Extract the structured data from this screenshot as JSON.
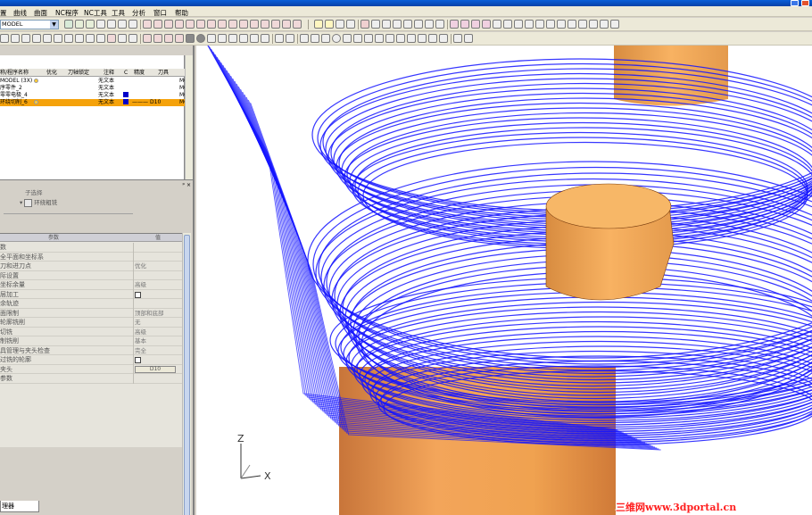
{
  "title_bar": {
    "text": ""
  },
  "menu": [
    "置",
    "曲线",
    "曲面",
    "NC程序",
    "NC工具",
    "工具",
    "分析",
    "窗口",
    "帮助"
  ],
  "model_combo": {
    "value": "MODEL"
  },
  "tree": {
    "headers": [
      "称/程序名称",
      "优化",
      "刀轴锁定",
      "注释",
      "C",
      "精度",
      "刀具",
      ""
    ],
    "rows": [
      {
        "name": "MODEL (3X)",
        "comment": "无文本",
        "tool": "",
        "tail": "MCC",
        "selected": false
      },
      {
        "name": "序零件_2",
        "comment": "无文本",
        "tool": "",
        "tail": "MCC",
        "selected": false
      },
      {
        "name": "零零电极_4",
        "comment": "无文本",
        "tool": "",
        "tail": "MCC",
        "selected": false
      },
      {
        "name": "环绕切削_6",
        "comment": "无文本",
        "tool": "D10",
        "tail": "MCC",
        "selected": true
      }
    ]
  },
  "mid_pane": {
    "sub_select": "子选择",
    "method": "环绕粗铣"
  },
  "params": {
    "header_left": "参数",
    "header_right": "值",
    "rows": [
      {
        "label": "数",
        "value": ""
      },
      {
        "label": "全平面和坐标系",
        "value": ""
      },
      {
        "label": "刀和进刀点",
        "value": "优化"
      },
      {
        "label": "际设置",
        "value": ""
      },
      {
        "label": "坐标余量",
        "value": "高级"
      },
      {
        "label": "层加工",
        "value": "",
        "checkbox": true
      },
      {
        "label": "余轨迹",
        "value": ""
      },
      {
        "label": "面限制",
        "value": "顶部和底部"
      },
      {
        "label": "轮廓铣削",
        "value": "无"
      },
      {
        "label": "切铣",
        "value": "高级"
      },
      {
        "label": "制铣削",
        "value": "基本"
      },
      {
        "label": "具管理与夹头检查",
        "value": "完全"
      },
      {
        "label": "过铣的轮廓",
        "value": "",
        "checkbox": true
      },
      {
        "label": "夹头",
        "value": "D10",
        "button": true
      },
      {
        "label": "参数",
        "value": ""
      }
    ]
  },
  "bottom_tab": "理器",
  "axes": {
    "z": "Z",
    "x": "X"
  },
  "watermark": "三维网www.3dportal.cn",
  "colors": {
    "toolpath": "#1414ff",
    "part": "#f0a64c",
    "selected_row": "#f5a20a"
  }
}
